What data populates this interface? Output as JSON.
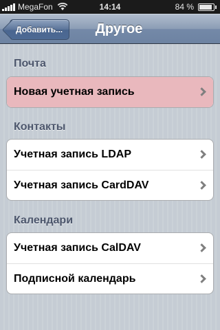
{
  "status_bar": {
    "carrier": "MegaFon",
    "time": "14:14",
    "battery_percent": "84 %",
    "battery_level": 0.84
  },
  "nav_bar": {
    "back_label": "Добавить...",
    "title": "Другое"
  },
  "sections": [
    {
      "header": "Почта",
      "items": [
        {
          "label": "Новая учетная запись",
          "selected": true
        }
      ]
    },
    {
      "header": "Контакты",
      "items": [
        {
          "label": "Учетная запись LDAP"
        },
        {
          "label": "Учетная запись CardDAV"
        }
      ]
    },
    {
      "header": "Календари",
      "items": [
        {
          "label": "Учетная запись CalDAV"
        },
        {
          "label": "Подписной календарь"
        }
      ]
    }
  ]
}
